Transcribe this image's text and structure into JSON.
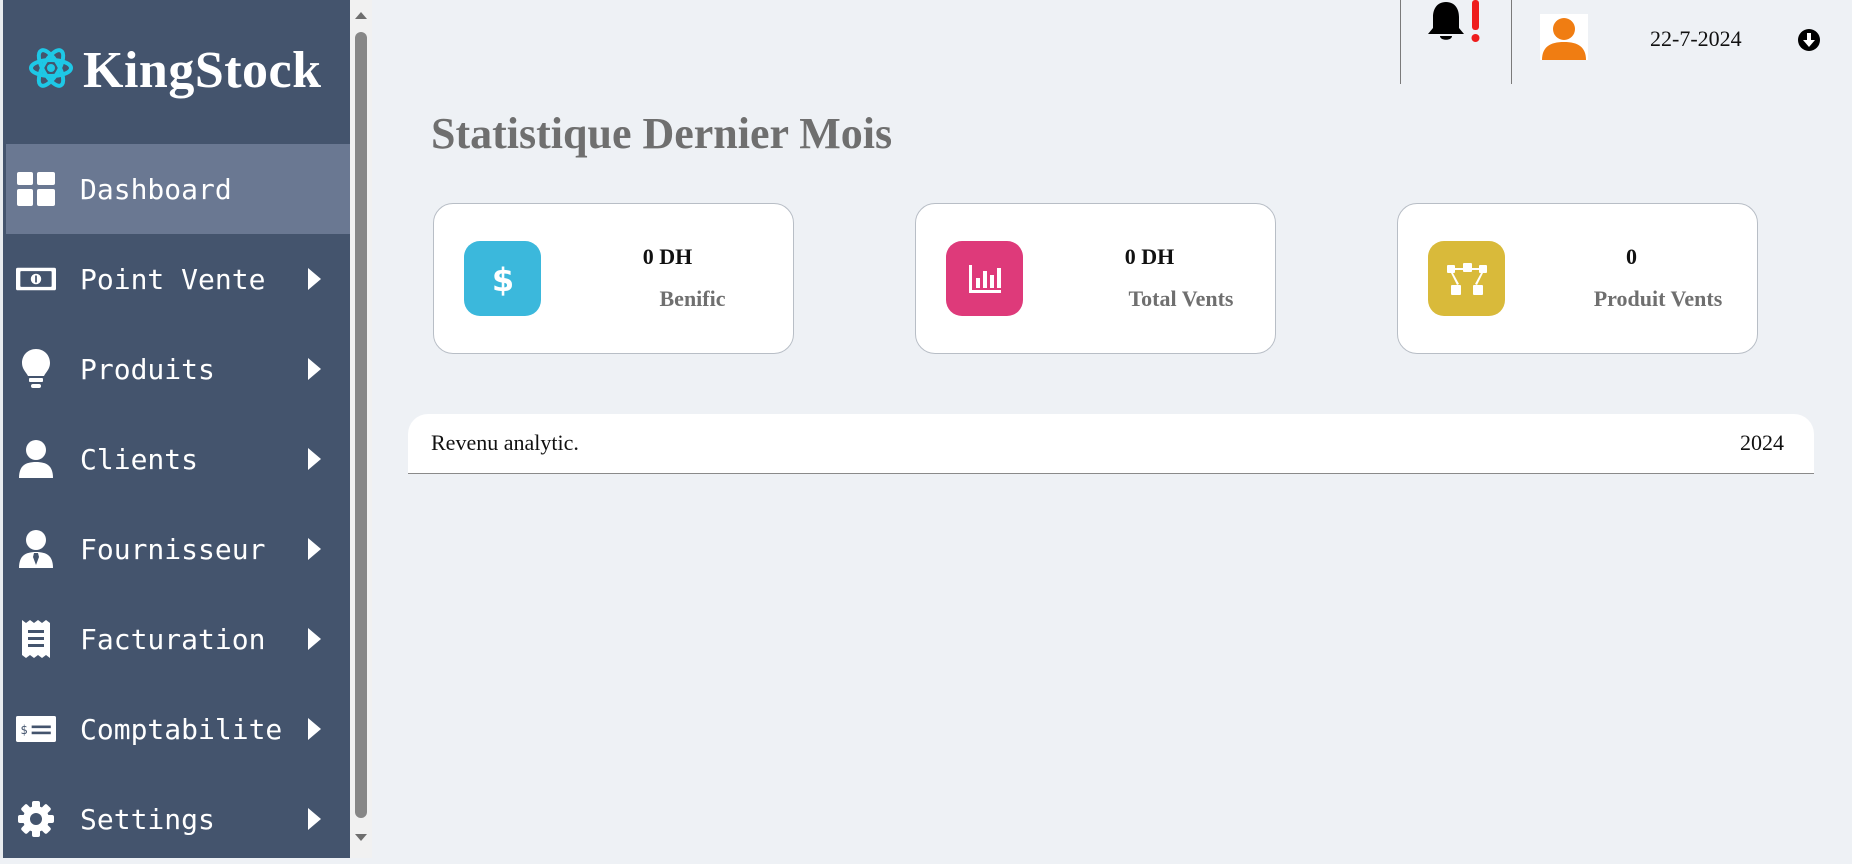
{
  "brand": {
    "name": "KingStock",
    "logo_icon": "atom-icon",
    "logo_color": "#1ec8e6"
  },
  "sidebar": {
    "background": "#44546d",
    "active_background": "#6a7892",
    "items": [
      {
        "label": "Dashboard",
        "icon": "dashboard-grid-icon",
        "active": true,
        "has_submenu": false
      },
      {
        "label": "Point Vente",
        "icon": "money-bill-icon",
        "active": false,
        "has_submenu": true
      },
      {
        "label": "Produits",
        "icon": "lightbulb-icon",
        "active": false,
        "has_submenu": true
      },
      {
        "label": "Clients",
        "icon": "user-icon",
        "active": false,
        "has_submenu": true
      },
      {
        "label": "Fournisseur",
        "icon": "user-tie-icon",
        "active": false,
        "has_submenu": true
      },
      {
        "label": "Facturation",
        "icon": "receipt-icon",
        "active": false,
        "has_submenu": true
      },
      {
        "label": "Comptabilite",
        "icon": "money-check-icon",
        "active": false,
        "has_submenu": true
      },
      {
        "label": "Settings",
        "icon": "gear-icon",
        "active": false,
        "has_submenu": true
      }
    ]
  },
  "header": {
    "notification_icon": "bell-alert-icon",
    "avatar_icon": "user-avatar-icon",
    "avatar_color": "#f07d12",
    "date": "22-7-2024",
    "menu_icon": "circle-arrow-down-icon"
  },
  "main": {
    "title": "Statistique Dernier Mois",
    "cards": [
      {
        "value": "0 DH",
        "label": "Benific",
        "icon": "dollar-icon",
        "color": "#3bb8dc"
      },
      {
        "value": "0 DH",
        "label": "Total Vents",
        "icon": "bar-chart-icon",
        "color": "#de3a7a"
      },
      {
        "value": "0",
        "label": "Produit Vents",
        "icon": "vector-nodes-icon",
        "color": "#d9ba3a"
      }
    ],
    "analytics": {
      "title": "Revenu analytic.",
      "year": "2024"
    }
  }
}
